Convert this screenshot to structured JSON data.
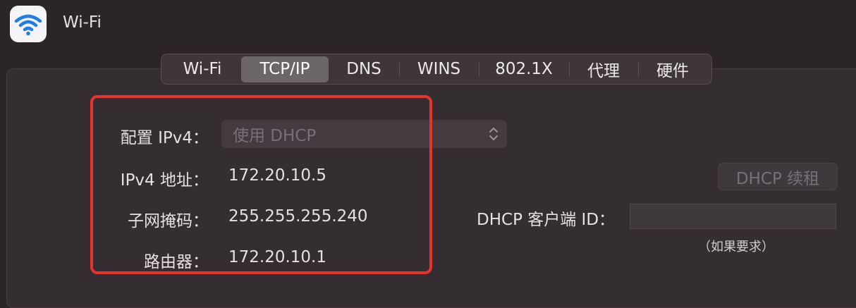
{
  "window": {
    "title": "Wi-Fi",
    "icon": "wifi-icon"
  },
  "tabs": [
    {
      "label": "Wi-Fi",
      "active": false
    },
    {
      "label": "TCP/IP",
      "active": true
    },
    {
      "label": "DNS",
      "active": false
    },
    {
      "label": "WINS",
      "active": false
    },
    {
      "label": "802.1X",
      "active": false
    },
    {
      "label": "代理",
      "active": false
    },
    {
      "label": "硬件",
      "active": false
    }
  ],
  "ipv4": {
    "configure_label": "配置 IPv4：",
    "configure_value": "使用 DHCP",
    "address_label": "IPv4 地址：",
    "address_value": "172.20.10.5",
    "subnet_label": "子网掩码：",
    "subnet_value": "255.255.255.240",
    "router_label": "路由器：",
    "router_value": "172.20.10.1"
  },
  "dhcp": {
    "renew_button": "DHCP 续租",
    "client_id_label": "DHCP 客户端 ID：",
    "client_id_value": "",
    "client_id_hint": "（如果要求）"
  },
  "colors": {
    "background": "#2b2428",
    "highlight": "#e8322f",
    "wifi_blue": "#1f7fe6"
  }
}
